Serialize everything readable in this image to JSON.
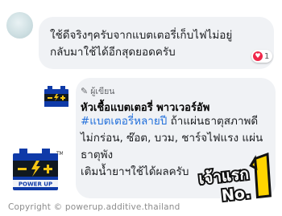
{
  "comment": {
    "text_line1": "ใช้ดีจริงๆครับจากแบตเตอรี่เก็บไฟไม่อยู่",
    "text_line2": "กลับมาใช้ได้อีกสุดยอดครับ",
    "reaction_count": "1"
  },
  "reply": {
    "author_tag": "ผู้เขียน",
    "author_name": "หัวเชื้อแบตเตอรี่ พาวเวอร์อัพ",
    "hashtag": "#แบตเตอรี่หลายปี",
    "text_after_hashtag": " ถ้าแผ่นธาตุสภาพดี ไม่กร่อน, ซ๊อต, บวม, ชาร์จไฟแรง แผ่นธาตุพัง",
    "text_line_last": "เติมน้ำยาฯใช้ได้ผลครับ"
  },
  "logo": {
    "brand_text": "POWER UP",
    "trademark": "TM"
  },
  "badge": {
    "text_top": "เจ้าแรก",
    "text_bottom": "No."
  },
  "copyright": "Copyright © powerup.additive.thailand",
  "colors": {
    "bubble": "#f0f2f5",
    "hashtag": "#216fdb",
    "heart": "#f0284a",
    "logo_blue": "#0f3aa8",
    "logo_yellow": "#f6c513",
    "badge_yellow": "#ffd400"
  }
}
